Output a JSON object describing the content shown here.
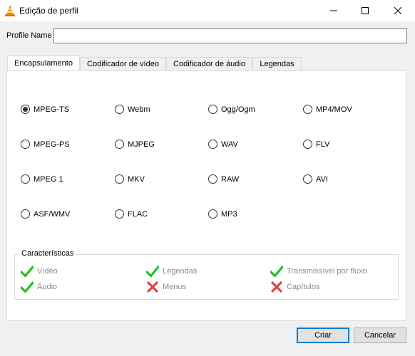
{
  "window": {
    "title": "Edição de perfil"
  },
  "profile": {
    "label": "Profile Name",
    "value": ""
  },
  "tabs": [
    {
      "label": "Encapsulamento",
      "active": true
    },
    {
      "label": "Codificador de vídeo",
      "active": false
    },
    {
      "label": "Codificador de áudio",
      "active": false
    },
    {
      "label": "Legendas",
      "active": false
    }
  ],
  "formats": [
    {
      "label": "MPEG-TS",
      "selected": true
    },
    {
      "label": "Webm",
      "selected": false
    },
    {
      "label": "Ogg/Ogm",
      "selected": false
    },
    {
      "label": "MP4/MOV",
      "selected": false
    },
    {
      "label": "MPEG-PS",
      "selected": false
    },
    {
      "label": "MJPEG",
      "selected": false
    },
    {
      "label": "WAV",
      "selected": false
    },
    {
      "label": "FLV",
      "selected": false
    },
    {
      "label": "MPEG 1",
      "selected": false
    },
    {
      "label": "MKV",
      "selected": false
    },
    {
      "label": "RAW",
      "selected": false
    },
    {
      "label": "AVI",
      "selected": false
    },
    {
      "label": "ASF/WMV",
      "selected": false
    },
    {
      "label": "FLAC",
      "selected": false
    },
    {
      "label": "MP3",
      "selected": false
    }
  ],
  "features": {
    "title": "Características",
    "items": [
      {
        "label": "Vídeo",
        "supported": true,
        "icon": "check-icon"
      },
      {
        "label": "Legendas",
        "supported": true,
        "icon": "check-icon"
      },
      {
        "label": "Transmissível por fluxo",
        "supported": true,
        "icon": "check-icon"
      },
      {
        "label": "Áudio",
        "supported": true,
        "icon": "check-icon"
      },
      {
        "label": "Menus",
        "supported": false,
        "icon": "cross-icon"
      },
      {
        "label": "Capítulos",
        "supported": false,
        "icon": "cross-icon"
      }
    ]
  },
  "buttons": {
    "create": "Criar",
    "cancel": "Cancelar"
  },
  "colors": {
    "check": "#2db92d",
    "cross": "#e04343",
    "accent": "#0078d7"
  }
}
